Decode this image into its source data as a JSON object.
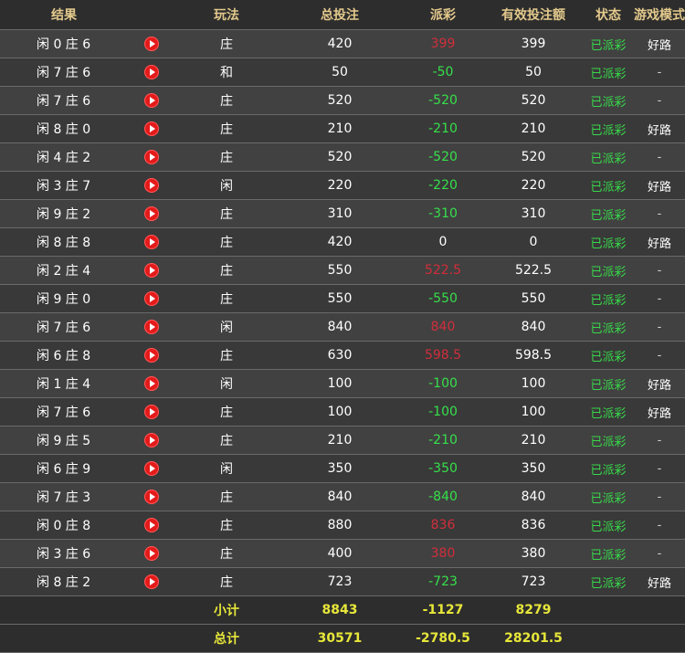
{
  "header": {
    "result": "结果",
    "play": "玩法",
    "total_bet": "总投注",
    "payout": "派彩",
    "valid_bet": "有效投注额",
    "status": "状态",
    "game_mode": "游戏模式"
  },
  "rows": [
    {
      "result": "闲 0 庄 6",
      "play": "庄",
      "total": "420",
      "payout": "399",
      "payout_type": "pos",
      "valid": "399",
      "status": "已派彩",
      "mode": "好路"
    },
    {
      "result": "闲 7 庄 6",
      "play": "和",
      "total": "50",
      "payout": "-50",
      "payout_type": "neg",
      "valid": "50",
      "status": "已派彩",
      "mode": "-"
    },
    {
      "result": "闲 7 庄 6",
      "play": "庄",
      "total": "520",
      "payout": "-520",
      "payout_type": "neg",
      "valid": "520",
      "status": "已派彩",
      "mode": "-"
    },
    {
      "result": "闲 8 庄 0",
      "play": "庄",
      "total": "210",
      "payout": "-210",
      "payout_type": "neg",
      "valid": "210",
      "status": "已派彩",
      "mode": "好路"
    },
    {
      "result": "闲 4 庄 2",
      "play": "庄",
      "total": "520",
      "payout": "-520",
      "payout_type": "neg",
      "valid": "520",
      "status": "已派彩",
      "mode": "-"
    },
    {
      "result": "闲 3 庄 7",
      "play": "闲",
      "total": "220",
      "payout": "-220",
      "payout_type": "neg",
      "valid": "220",
      "status": "已派彩",
      "mode": "好路"
    },
    {
      "result": "闲 9 庄 2",
      "play": "庄",
      "total": "310",
      "payout": "-310",
      "payout_type": "neg",
      "valid": "310",
      "status": "已派彩",
      "mode": "-"
    },
    {
      "result": "闲 8 庄 8",
      "play": "庄",
      "total": "420",
      "payout": "0",
      "payout_type": "zero",
      "valid": "0",
      "status": "已派彩",
      "mode": "好路"
    },
    {
      "result": "闲 2 庄 4",
      "play": "庄",
      "total": "550",
      "payout": "522.5",
      "payout_type": "pos",
      "valid": "522.5",
      "status": "已派彩",
      "mode": "-"
    },
    {
      "result": "闲 9 庄 0",
      "play": "庄",
      "total": "550",
      "payout": "-550",
      "payout_type": "neg",
      "valid": "550",
      "status": "已派彩",
      "mode": "-"
    },
    {
      "result": "闲 7 庄 6",
      "play": "闲",
      "total": "840",
      "payout": "840",
      "payout_type": "pos",
      "valid": "840",
      "status": "已派彩",
      "mode": "-"
    },
    {
      "result": "闲 6 庄 8",
      "play": "庄",
      "total": "630",
      "payout": "598.5",
      "payout_type": "pos",
      "valid": "598.5",
      "status": "已派彩",
      "mode": "-"
    },
    {
      "result": "闲 1 庄 4",
      "play": "闲",
      "total": "100",
      "payout": "-100",
      "payout_type": "neg",
      "valid": "100",
      "status": "已派彩",
      "mode": "好路"
    },
    {
      "result": "闲 7 庄 6",
      "play": "庄",
      "total": "100",
      "payout": "-100",
      "payout_type": "neg",
      "valid": "100",
      "status": "已派彩",
      "mode": "好路"
    },
    {
      "result": "闲 9 庄 5",
      "play": "庄",
      "total": "210",
      "payout": "-210",
      "payout_type": "neg",
      "valid": "210",
      "status": "已派彩",
      "mode": "-"
    },
    {
      "result": "闲 6 庄 9",
      "play": "闲",
      "total": "350",
      "payout": "-350",
      "payout_type": "neg",
      "valid": "350",
      "status": "已派彩",
      "mode": "-"
    },
    {
      "result": "闲 7 庄 3",
      "play": "庄",
      "total": "840",
      "payout": "-840",
      "payout_type": "neg",
      "valid": "840",
      "status": "已派彩",
      "mode": "-"
    },
    {
      "result": "闲 0 庄 8",
      "play": "庄",
      "total": "880",
      "payout": "836",
      "payout_type": "pos",
      "valid": "836",
      "status": "已派彩",
      "mode": "-"
    },
    {
      "result": "闲 3 庄 6",
      "play": "庄",
      "total": "400",
      "payout": "380",
      "payout_type": "pos",
      "valid": "380",
      "status": "已派彩",
      "mode": "-"
    },
    {
      "result": "闲 8 庄 2",
      "play": "庄",
      "total": "723",
      "payout": "-723",
      "payout_type": "neg",
      "valid": "723",
      "status": "已派彩",
      "mode": "好路"
    }
  ],
  "subtotal": {
    "label": "小计",
    "total": "8843",
    "payout": "-1127",
    "valid": "8279"
  },
  "grand_total": {
    "label": "总计",
    "total": "30571",
    "payout": "-2780.5",
    "valid": "28201.5"
  },
  "icons": {
    "row_action": "play-icon"
  },
  "colors": {
    "header_text": "#e3c98c",
    "status_green": "#38d84a",
    "negative_payout": "#36e04b",
    "positive_payout": "#d12e3b",
    "total_text": "#e7e73a"
  }
}
